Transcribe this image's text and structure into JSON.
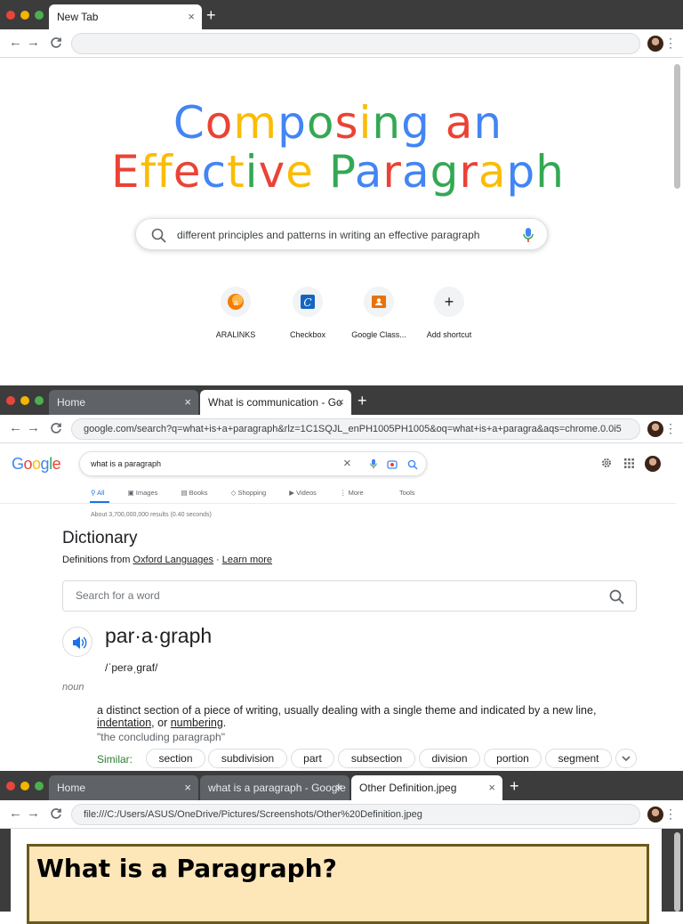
{
  "window1": {
    "tabs": [
      {
        "label": "New Tab",
        "close": "×"
      }
    ],
    "new_tab": "+",
    "nav": {
      "back": "←",
      "forward": "→",
      "reload": "C"
    },
    "address": "",
    "title_line1": [
      "C",
      "o",
      "m",
      "p",
      "o",
      "s",
      "i",
      "n",
      "g",
      " ",
      "a",
      "n"
    ],
    "title_line2": [
      "E",
      "f",
      "f",
      "e",
      "c",
      "t",
      "i",
      "v",
      "e",
      " ",
      "P",
      "a",
      "r",
      "a",
      "g",
      "r",
      "a",
      "p",
      "h"
    ],
    "title_colors": {
      "blue": "#4285f4",
      "red": "#ea4335",
      "yellow": "#fbbc05",
      "green": "#34a853"
    },
    "search_query": "different principles and patterns in writing an effective paragraph",
    "shortcuts": [
      {
        "label": "ARALINKS",
        "icon": "aralinks-icon"
      },
      {
        "label": "Checkbox",
        "icon": "checkbox-c-icon"
      },
      {
        "label": "Google Class...",
        "icon": "google-classroom-icon"
      },
      {
        "label": "Add shortcut",
        "icon": "plus-icon",
        "symbol": "+"
      }
    ]
  },
  "window2": {
    "tabs": [
      {
        "label": "Home",
        "close": "×"
      },
      {
        "label": "What is communication - Go",
        "close": "×"
      }
    ],
    "new_tab": "+",
    "address": "google.com/search?q=what+is+a+paragraph&rlz=1C1SQJL_enPH1005PH1005&oq=what+is+a+paragra&aqs=chrome.0.0i5",
    "logo": [
      "G",
      "o",
      "o",
      "g",
      "l",
      "e"
    ],
    "search_query": "what is a paragraph",
    "clear": "×",
    "search_tabs": [
      "All",
      "Images",
      "Books",
      "Shopping",
      "Videos",
      "More"
    ],
    "tools": "Tools",
    "result_stats": "About 3,700,000,000 results (0.40 seconds)",
    "dictionary": {
      "heading": "Dictionary",
      "defs_from": "Definitions from",
      "source": "Oxford Languages",
      "sep": " · ",
      "learn_more": "Learn more",
      "word_search_placeholder": "Search for a word",
      "headword": "par·a·graph",
      "phonetic": "/ˈperəˌɡraf/",
      "part_of_speech": "noun",
      "definition_pre": "a distinct section of a piece of writing, usually dealing with a single theme and indicated by a new line, ",
      "definition_link1": "indentation",
      "definition_mid": ", or ",
      "definition_link2": "numbering",
      "definition_end": ".",
      "example": "\"the concluding paragraph\"",
      "similar_label": "Similar:",
      "similar": [
        "section",
        "subdivision",
        "part",
        "subsection",
        "division",
        "portion",
        "segment"
      ]
    }
  },
  "window3": {
    "tabs": [
      {
        "label": "Home",
        "close": "×"
      },
      {
        "label": "what is a paragraph - Google",
        "close": "×"
      },
      {
        "label": "Other Definition.jpeg",
        "close": "×"
      }
    ],
    "new_tab": "+",
    "address": "file:///C:/Users/ASUS/OneDrive/Pictures/Screenshots/Other%20Definition.jpeg",
    "image_title": "What is a Paragraph?"
  },
  "menu": "⋮"
}
